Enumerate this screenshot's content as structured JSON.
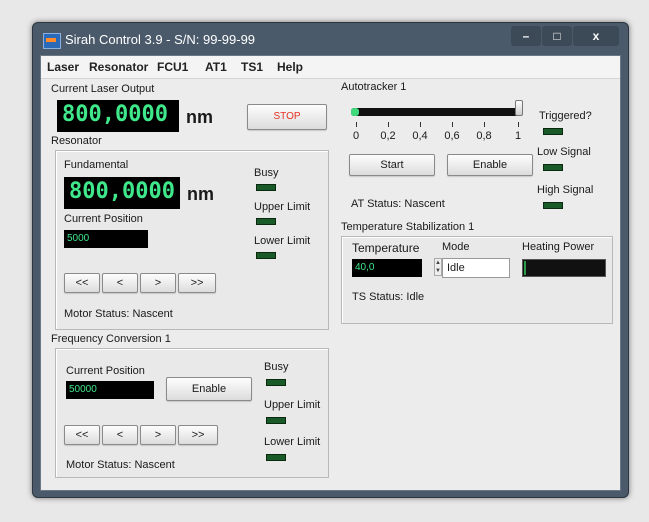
{
  "window": {
    "title": "Sirah Control 3.9 - S/N: 99-99-99",
    "buttons": {
      "minimize": "–",
      "maximize": "□",
      "close": "x"
    }
  },
  "menu": [
    "Laser",
    "Resonator",
    "FCU1",
    "AT1",
    "TS1",
    "Help"
  ],
  "laser_output": {
    "label": "Current Laser Output",
    "value": "800,0000",
    "unit": "nm",
    "stop_label": "STOP"
  },
  "resonator": {
    "group_label": "Resonator",
    "fundamental_label": "Fundamental",
    "fundamental_value": "800,0000",
    "unit": "nm",
    "position_label": "Current Position",
    "position_value": "5000",
    "buttons": [
      "<<",
      "<",
      ">",
      ">>"
    ],
    "motor_status": "Motor Status: Nascent",
    "indicators": [
      "Busy",
      "Upper Limit",
      "Lower Limit"
    ]
  },
  "frequency_conversion": {
    "group_label": "Frequency Conversion 1",
    "position_label": "Current Position",
    "position_value": "50000",
    "enable_label": "Enable",
    "buttons": [
      "<<",
      "<",
      ">",
      ">>"
    ],
    "motor_status": "Motor Status: Nascent",
    "indicators": [
      "Busy",
      "Upper Limit",
      "Lower Limit"
    ]
  },
  "autotracker": {
    "group_label": "Autotracker 1",
    "slider_value": 1,
    "tick_labels": [
      "0",
      "0,2",
      "0,4",
      "0,6",
      "0,8",
      "1"
    ],
    "start_label": "Start",
    "enable_label": "Enable",
    "status": "AT Status: Nascent",
    "indicators": [
      "Triggered?",
      "Low Signal",
      "High Signal"
    ]
  },
  "temperature_stabilization": {
    "group_label": "Temperature Stabilization 1",
    "temperature_label": "Temperature",
    "temperature_value": "40,0",
    "mode_label": "Mode",
    "mode_value": "Idle",
    "heating_label": "Heating Power",
    "heating_power_fraction": 0.02,
    "status": "TS Status: Idle"
  },
  "colors": {
    "display_text": "#3fe88a",
    "display_bg": "#000000",
    "led_off": "#1a5a28",
    "stop_text": "#e83020",
    "title_bar": "#4a5a6a"
  }
}
